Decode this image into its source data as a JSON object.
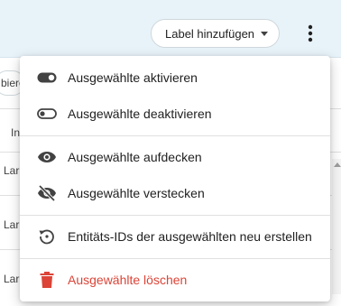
{
  "toolbar": {
    "label_button": "Label hinzufügen"
  },
  "background": {
    "filter_partial": "biere",
    "column_header_partial": "In",
    "row_partials": [
      "Lar",
      "Lar",
      "Lar"
    ]
  },
  "menu": {
    "items": [
      {
        "label": "Ausgewählte aktivieren",
        "icon": "toggle-on-icon"
      },
      {
        "label": "Ausgewählte deaktivieren",
        "icon": "toggle-off-icon"
      },
      {
        "label": "Ausgewählte aufdecken",
        "icon": "eye-icon"
      },
      {
        "label": "Ausgewählte verstecken",
        "icon": "eye-off-icon"
      },
      {
        "label": "Entitäts-IDs der ausgewählten neu erstellen",
        "icon": "restore-icon"
      },
      {
        "label": "Ausgewählte löschen",
        "icon": "trash-icon"
      }
    ]
  },
  "colors": {
    "header_bg": "#e8f3f9",
    "danger": "#db4437",
    "icon": "#424242"
  }
}
